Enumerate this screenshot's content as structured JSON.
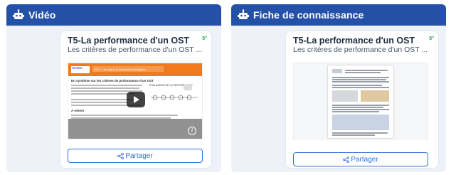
{
  "panels": [
    {
      "header": "Vidéo",
      "card": {
        "title": "T5-La performance d'un OST",
        "subtitle": "Les critères de performance d'un OST ...",
        "badge": "5°",
        "share_label": "Partager"
      },
      "thumbnail": {
        "banner": "OST : Les objets et systèmes techniques",
        "heading": "En synthèse sur les critères de performance d'un OST",
        "chart_title": "ÉVALUATION DE LA PERFORMANCE",
        "subheading": "A retenir"
      }
    },
    {
      "header": "Fiche de connaissance",
      "card": {
        "title": "T5-La performance d'un OST",
        "subtitle": "Les critères de performance d'un OST ...",
        "badge": "5°",
        "share_label": "Partager"
      }
    }
  ],
  "colors": {
    "header": "#2450a8",
    "accent": "#2f6fd6",
    "badge": "#22a046"
  },
  "icons": [
    "robot-icon",
    "play-icon",
    "info-icon",
    "share-icon"
  ]
}
